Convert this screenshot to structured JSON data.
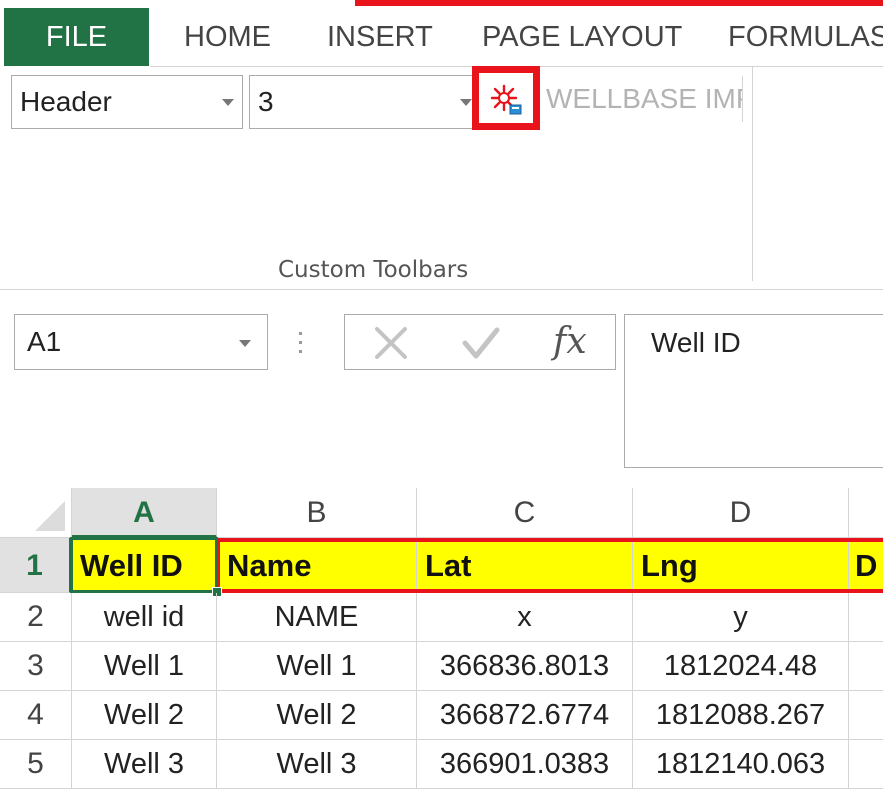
{
  "ribbon_tabs": [
    {
      "label": "FILE",
      "active": true
    },
    {
      "label": "HOME"
    },
    {
      "label": "INSERT"
    },
    {
      "label": "PAGE LAYOUT"
    },
    {
      "label": "FORMULAS"
    }
  ],
  "custom_toolbar": {
    "header_combo": "Header",
    "number_combo": "3",
    "addin_icon": "spark-addin-icon",
    "wellbase_button": "WELLBASE IMPORT",
    "group_label": "Custom Toolbars"
  },
  "formula_bar": {
    "name_box": "A1",
    "cancel_icon": "x-icon",
    "enter_icon": "check-icon",
    "fx_label": "fx",
    "formula_value": "Well ID"
  },
  "sheet": {
    "columns": [
      "A",
      "B",
      "C",
      "D"
    ],
    "rows": [
      {
        "num": "1",
        "cells": [
          "Well ID",
          "Name",
          "Lat",
          "Lng",
          "D"
        ]
      },
      {
        "num": "2",
        "cells": [
          "well id",
          "NAME",
          "x",
          "y"
        ]
      },
      {
        "num": "3",
        "cells": [
          "Well 1",
          "Well 1",
          "366836.8013",
          "1812024.48"
        ]
      },
      {
        "num": "4",
        "cells": [
          "Well 2",
          "Well 2",
          "366872.6774",
          "1812088.267"
        ]
      },
      {
        "num": "5",
        "cells": [
          "Well 3",
          "Well 3",
          "366901.0383",
          "1812140.063"
        ]
      }
    ]
  },
  "colors": {
    "excel_green": "#217346",
    "highlight_red": "#e8131b",
    "header_yellow": "#ffff00"
  }
}
